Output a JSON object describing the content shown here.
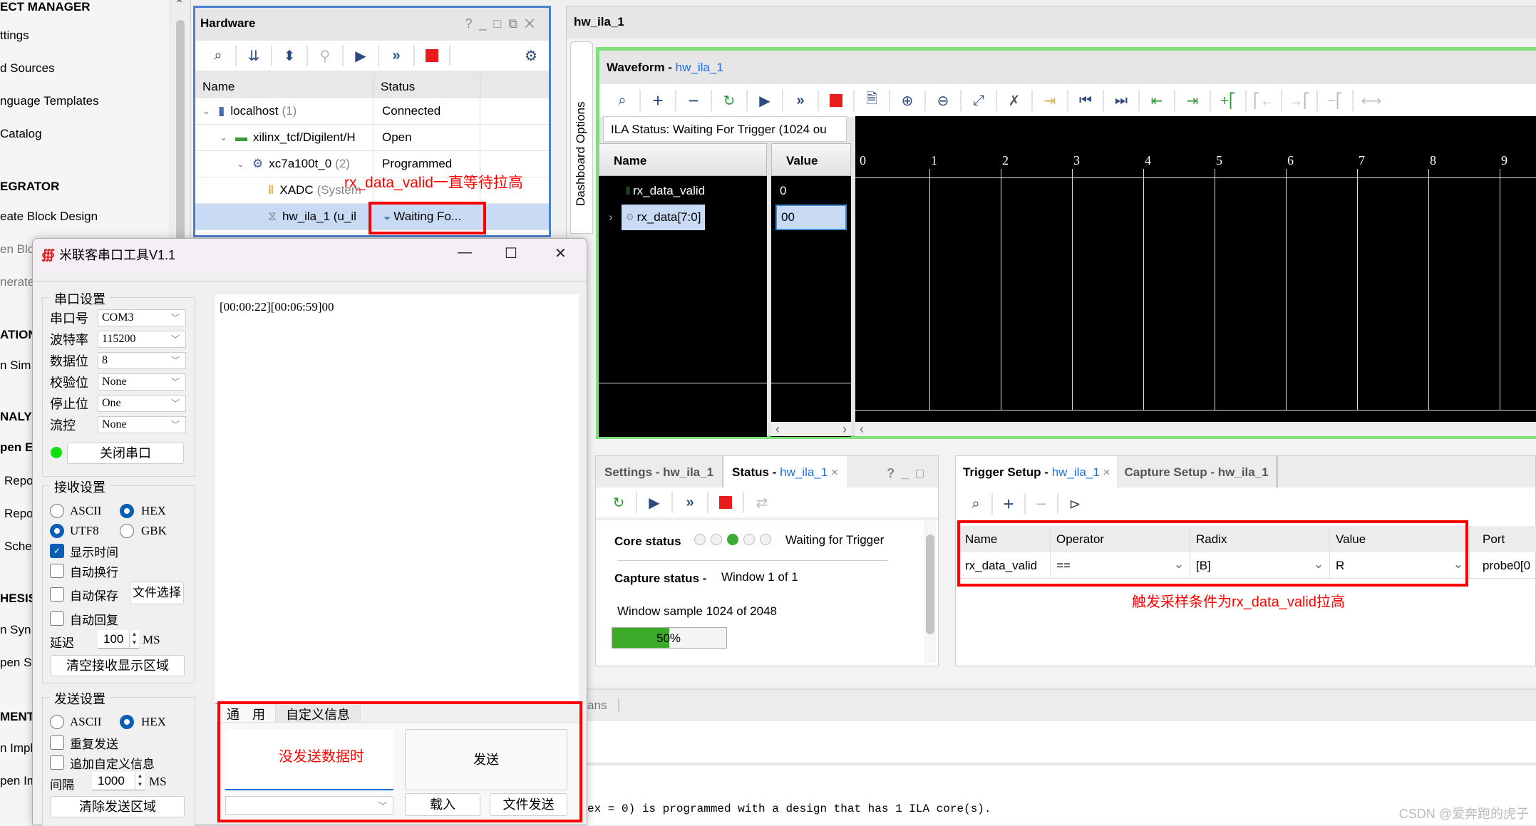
{
  "flow_navigator": {
    "items": [
      {
        "label": "ECT MANAGER",
        "kind": "heading"
      },
      {
        "label": "ttings",
        "kind": "item"
      },
      {
        "label": "d Sources",
        "kind": "item"
      },
      {
        "label": "nguage Templates",
        "kind": "item"
      },
      {
        "label": "Catalog",
        "kind": "item"
      },
      {
        "label": "EGRATOR",
        "kind": "heading-plain"
      },
      {
        "label": "eate Block Design",
        "kind": "item"
      },
      {
        "label": "en Blo",
        "kind": "dim"
      },
      {
        "label": "nerate",
        "kind": "dim"
      },
      {
        "label": "ATION",
        "kind": "heading-plain"
      },
      {
        "label": "n Sim",
        "kind": "item"
      },
      {
        "label": "NALY",
        "kind": "heading"
      },
      {
        "label": "pen El",
        "kind": "heading"
      },
      {
        "label": "Repo",
        "kind": "item"
      },
      {
        "label": "Repo",
        "kind": "item"
      },
      {
        "label": "Sche",
        "kind": "item"
      },
      {
        "label": "HESIS",
        "kind": "heading-plain"
      },
      {
        "label": "n Syn",
        "kind": "item"
      },
      {
        "label": "pen Sy",
        "kind": "item"
      },
      {
        "label": "MENT",
        "kind": "heading-plain"
      },
      {
        "label": "n Impl",
        "kind": "item"
      },
      {
        "label": "pen Im",
        "kind": "item"
      }
    ]
  },
  "hardware": {
    "title": "Hardware",
    "window_buttons": [
      "?",
      "_",
      "□",
      "↗",
      "✕"
    ],
    "columns": [
      "Name",
      "Status"
    ],
    "rows": [
      {
        "name": "localhost",
        "count": "(1)",
        "status": "Connected",
        "icon": "server-icon"
      },
      {
        "name": "xilinx_tcf/Digilent/H",
        "count": "",
        "status": "Open",
        "icon": "board-icon"
      },
      {
        "name": "xc7a100t_0",
        "count": "(2)",
        "status": "Programmed",
        "icon": "chip-icon"
      },
      {
        "name": "XADC",
        "count": "(System",
        "status": "",
        "icon": "xadc-icon"
      },
      {
        "name": "hw_ila_1 (u_il",
        "count": "",
        "status": "Waiting Fo...",
        "icon": "ila-icon",
        "selected": true
      }
    ],
    "annotation": "rx_data_valid一直等待拉高"
  },
  "ila": {
    "header": "hw_ila_1",
    "dashboard_tab": "Dashboard Options",
    "waveform": {
      "title": "Waveform - ",
      "title_link": "hw_ila_1",
      "ila_status": "ILA Status:  Waiting For Trigger (1024 ou",
      "name_header": "Name",
      "value_header": "Value",
      "signals": [
        {
          "name": "rx_data_valid",
          "value": "0",
          "icon": "signal-icon"
        },
        {
          "name": "rx_data[7:0]",
          "value": "00",
          "icon": "bus-icon",
          "selected": true
        }
      ],
      "time_ticks": [
        "0",
        "1",
        "2",
        "3",
        "4",
        "5",
        "6",
        "7",
        "8",
        "9"
      ]
    },
    "status_panel": {
      "tabs": [
        {
          "label": "Settings - hw_ila_1",
          "active": false
        },
        {
          "label": "Status - ",
          "link": "hw_ila_1",
          "active": true
        }
      ],
      "core_status_label": "Core status",
      "core_status_value": "Waiting for Trigger",
      "core_status_step": 3,
      "core_status_steps": 5,
      "capture_status_label": "Capture status -",
      "capture_status_value": "Window 1 of 1",
      "window_sample": "Window sample 1024 of 2048",
      "progress_percent": 50,
      "progress_label": "50%"
    },
    "trigger_panel": {
      "tabs": [
        {
          "label": "Trigger Setup - ",
          "link": "hw_ila_1",
          "active": true
        },
        {
          "label": "Capture Setup - hw_ila_1",
          "active": false
        }
      ],
      "columns": [
        "Name",
        "Operator",
        "Radix",
        "Value",
        "Port"
      ],
      "rows": [
        {
          "name": "rx_data_valid",
          "operator": "==",
          "radix": "[B]",
          "value": "R",
          "port": "probe0[0"
        }
      ],
      "annotation": "触发采样条件为rx_data_valid拉高"
    },
    "console": {
      "tab_fragment": "ans",
      "line": "ex = 0) is programmed with a design that has 1 ILA core(s)."
    }
  },
  "serial_tool": {
    "title": "米联客串口工具V1.1",
    "port_settings": {
      "group_title": "串口设置",
      "fields": [
        {
          "label": "串口号",
          "value": "COM3"
        },
        {
          "label": "波特率",
          "value": "115200"
        },
        {
          "label": "数据位",
          "value": "8"
        },
        {
          "label": "校验位",
          "value": "None"
        },
        {
          "label": "停止位",
          "value": "One"
        },
        {
          "label": "流控",
          "value": "None"
        }
      ],
      "open_status": "connected",
      "close_button": "关闭串口"
    },
    "receive_settings": {
      "group_title": "接收设置",
      "ascii": "ASCII",
      "hex": "HEX",
      "utf8": "UTF8",
      "gbk": "GBK",
      "show_time": "显示时间",
      "auto_wrap": "自动换行",
      "auto_save": "自动保存",
      "file_select": "文件选择",
      "auto_reply": "自动回复",
      "delay_label": "延迟",
      "delay_value": "100",
      "delay_unit": "MS",
      "clear_button": "清空接收显示区域"
    },
    "send_settings": {
      "group_title": "发送设置",
      "ascii": "ASCII",
      "hex": "HEX",
      "repeat_send": "重复发送",
      "append_custom": "追加自定义信息",
      "interval_label": "间隔",
      "interval_value": "1000",
      "interval_unit": "MS",
      "clear_button": "清除发送区域"
    },
    "receive_text": "[00:00:22][00:06:59]00",
    "send_tabs": [
      "通　用",
      "自定义信息"
    ],
    "send_annotation": "没发送数据时",
    "send_button": "发送",
    "load_button": "载入",
    "file_send_button": "文件发送"
  },
  "watermark": "CSDN @爱奔跑的虎子"
}
